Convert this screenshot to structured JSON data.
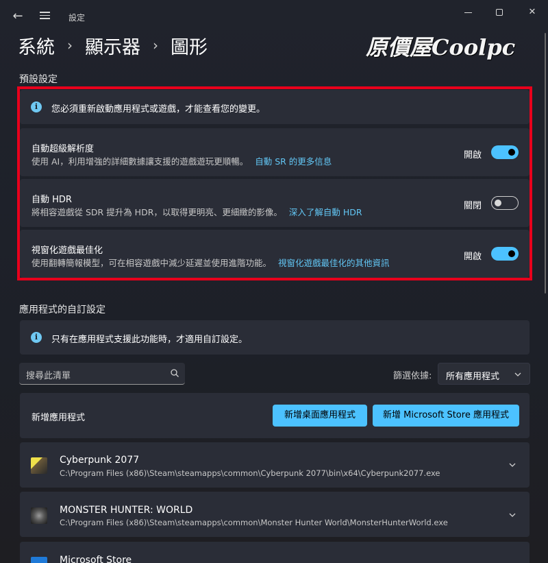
{
  "window": {
    "title": "設定"
  },
  "breadcrumb": {
    "items": [
      "系統",
      "顯示器",
      "圖形"
    ]
  },
  "logo": {
    "text": "原價屋Coolpc"
  },
  "defaults": {
    "section_label": "預設設定",
    "info": "您必須重新啟動應用程式或遊戲，才能查看您的變更。",
    "settings": [
      {
        "title": "自動超級解析度",
        "desc": "使用 AI，利用增強的詳細數據讓支援的遊戲遊玩更順暢。",
        "link": "自動 SR 的更多信息",
        "state": "開啟",
        "on": true
      },
      {
        "title": "自動 HDR",
        "desc": "將相容遊戲從 SDR 提升為 HDR，以取得更明亮、更細緻的影像。",
        "link": "深入了解自動 HDR",
        "state": "關閉",
        "on": false
      },
      {
        "title": "視窗化遊戲最佳化",
        "desc": "使用翻轉簡報模型，可在相容遊戲中減少延遲並使用進階功能。",
        "link": "視窗化遊戲最佳化的其他資訊",
        "state": "開啟",
        "on": true
      }
    ]
  },
  "custom": {
    "section_label": "應用程式的自訂設定",
    "info": "只有在應用程式支援此功能時，才適用自訂設定。",
    "search_placeholder": "搜尋此清單",
    "filter_label": "篩選依據:",
    "filter_value": "所有應用程式",
    "add_label": "新增應用程式",
    "add_desktop_button": "新增桌面應用程式",
    "add_store_button": "新增 Microsoft Store 應用程式",
    "apps": [
      {
        "name": "Cyberpunk 2077",
        "path": "C:\\Program Files (x86)\\Steam\\steamapps\\common\\Cyberpunk 2077\\bin\\x64\\Cyberpunk2077.exe"
      },
      {
        "name": "MONSTER HUNTER: WORLD",
        "path": "C:\\Program Files (x86)\\Steam\\steamapps\\common\\Monster Hunter World\\MonsterHunterWorld.exe"
      },
      {
        "name": "Microsoft Store",
        "path": ""
      }
    ]
  },
  "colors": {
    "accent": "#4cc2ff",
    "link": "#62c6f4",
    "highlight": "#e8001c",
    "card": "#2a2d37"
  }
}
